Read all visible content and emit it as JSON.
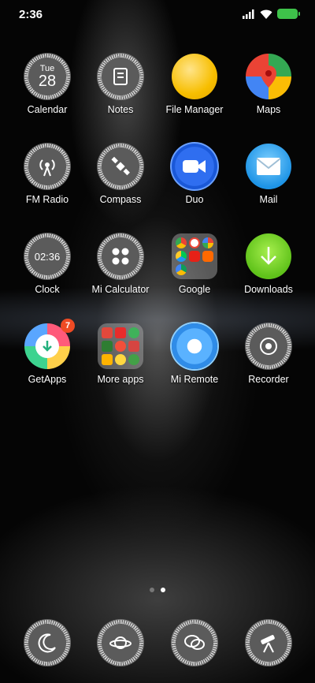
{
  "status": {
    "time": "2:36"
  },
  "apps": {
    "calendar": {
      "label": "Calendar",
      "day": "Tue",
      "date": "28"
    },
    "notes": {
      "label": "Notes"
    },
    "file_manager": {
      "label": "File Manager"
    },
    "maps": {
      "label": "Maps"
    },
    "fm_radio": {
      "label": "FM Radio"
    },
    "compass": {
      "label": "Compass"
    },
    "duo": {
      "label": "Duo"
    },
    "mail": {
      "label": "Mail"
    },
    "clock": {
      "label": "Clock",
      "time": "02:36"
    },
    "calculator": {
      "label": "Mi Calculator"
    },
    "google": {
      "label": "Google"
    },
    "downloads": {
      "label": "Downloads"
    },
    "getapps": {
      "label": "GetApps",
      "badge": "7"
    },
    "more_apps": {
      "label": "More apps"
    },
    "mi_remote": {
      "label": "Mi Remote"
    },
    "recorder": {
      "label": "Recorder"
    }
  },
  "page_indicator": {
    "count": 2,
    "active": 2
  }
}
